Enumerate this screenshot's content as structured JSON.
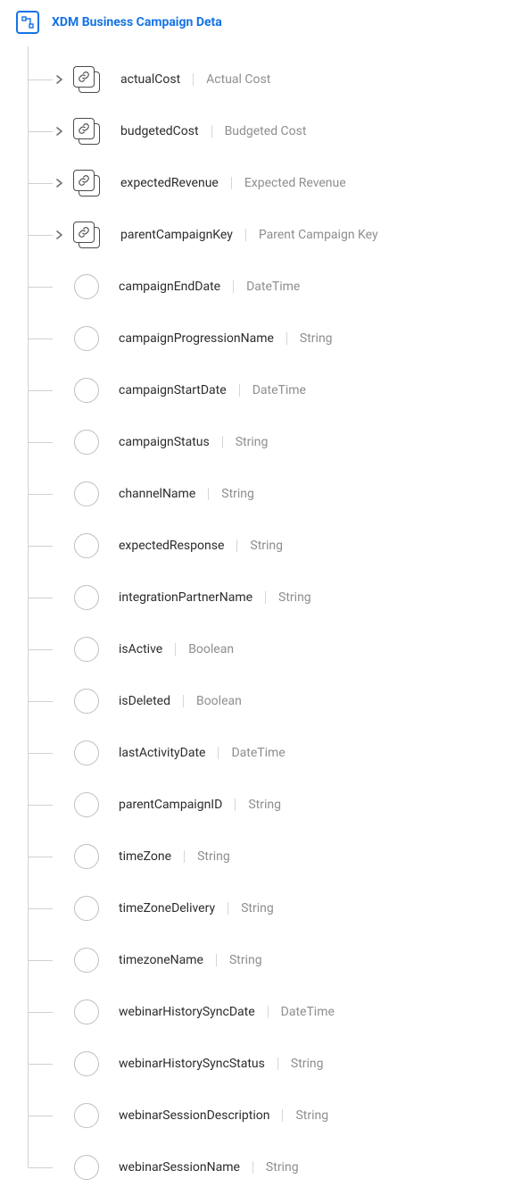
{
  "root": {
    "title": "XDM Business Campaign Deta"
  },
  "nodes": [
    {
      "kind": "object",
      "name": "actualCost",
      "label": "Actual Cost",
      "expandable": true
    },
    {
      "kind": "object",
      "name": "budgetedCost",
      "label": "Budgeted Cost",
      "expandable": true
    },
    {
      "kind": "object",
      "name": "expectedRevenue",
      "label": "Expected Revenue",
      "expandable": true
    },
    {
      "kind": "object",
      "name": "parentCampaignKey",
      "label": "Parent Campaign Key",
      "expandable": true
    },
    {
      "kind": "leaf",
      "name": "campaignEndDate",
      "label": "DateTime"
    },
    {
      "kind": "leaf",
      "name": "campaignProgressionName",
      "label": "String"
    },
    {
      "kind": "leaf",
      "name": "campaignStartDate",
      "label": "DateTime"
    },
    {
      "kind": "leaf",
      "name": "campaignStatus",
      "label": "String"
    },
    {
      "kind": "leaf",
      "name": "channelName",
      "label": "String"
    },
    {
      "kind": "leaf",
      "name": "expectedResponse",
      "label": "String"
    },
    {
      "kind": "leaf",
      "name": "integrationPartnerName",
      "label": "String"
    },
    {
      "kind": "leaf",
      "name": "isActive",
      "label": "Boolean"
    },
    {
      "kind": "leaf",
      "name": "isDeleted",
      "label": "Boolean"
    },
    {
      "kind": "leaf",
      "name": "lastActivityDate",
      "label": "DateTime"
    },
    {
      "kind": "leaf",
      "name": "parentCampaignID",
      "label": "String"
    },
    {
      "kind": "leaf",
      "name": "timeZone",
      "label": "String"
    },
    {
      "kind": "leaf",
      "name": "timeZoneDelivery",
      "label": "String"
    },
    {
      "kind": "leaf",
      "name": "timezoneName",
      "label": "String"
    },
    {
      "kind": "leaf",
      "name": "webinarHistorySyncDate",
      "label": "DateTime"
    },
    {
      "kind": "leaf",
      "name": "webinarHistorySyncStatus",
      "label": "String"
    },
    {
      "kind": "leaf",
      "name": "webinarSessionDescription",
      "label": "String"
    },
    {
      "kind": "leaf",
      "name": "webinarSessionName",
      "label": "String"
    }
  ]
}
